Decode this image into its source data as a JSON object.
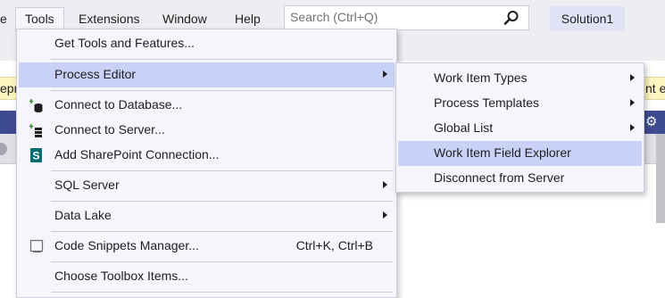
{
  "menubar": {
    "items": [
      {
        "label": "e"
      },
      {
        "label": "Tools"
      },
      {
        "label": "Extensions"
      },
      {
        "label": "Window"
      },
      {
        "label": "Help"
      }
    ],
    "search_placeholder": "Search (Ctrl+Q)",
    "solution_name": "Solution1"
  },
  "info_bar": {
    "left_fragment": "epr",
    "right_fragment": "nt e"
  },
  "tools_menu": {
    "items": [
      {
        "label": "Get Tools and Features..."
      },
      {
        "label": "Process Editor"
      },
      {
        "label": "Connect to Database..."
      },
      {
        "label": "Connect to Server..."
      },
      {
        "label": "Add SharePoint Connection..."
      },
      {
        "label": "SQL Server"
      },
      {
        "label": "Data Lake"
      },
      {
        "label": "Code Snippets Manager...",
        "shortcut": "Ctrl+K, Ctrl+B"
      },
      {
        "label": "Choose Toolbox Items..."
      }
    ]
  },
  "process_editor_submenu": {
    "items": [
      {
        "label": "Work Item Types"
      },
      {
        "label": "Process Templates"
      },
      {
        "label": "Global List"
      },
      {
        "label": "Work Item Field Explorer"
      },
      {
        "label": "Disconnect from Server"
      }
    ]
  },
  "colors": {
    "menu_background": "#f5f5fb",
    "highlight": "#c9d1f7",
    "menubar": "#eeeef2",
    "info_bar": "#fdf4bf",
    "dark_header": "#3f4b8f"
  }
}
